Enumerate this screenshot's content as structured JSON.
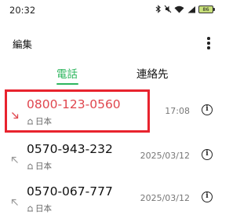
{
  "status_bar": {
    "time": "20:32",
    "battery": "86",
    "icons": [
      "bluetooth-icon",
      "mute-icon",
      "wifi-icon",
      "mobile-signal-icon",
      "battery-icon"
    ]
  },
  "header": {
    "edit_label": "編集",
    "more_icon": "more-vertical-icon"
  },
  "tabs": [
    {
      "label": "電話",
      "active": true
    },
    {
      "label": "連絡先",
      "active": false
    }
  ],
  "colors": {
    "accent": "#2eb65e",
    "missed": "#e0464e",
    "highlight": "#e8232e"
  },
  "calls": [
    {
      "number": "0800-123-0560",
      "location": "日本",
      "time": "17:08",
      "type": "missed",
      "arrow_icon": "incoming-call-icon",
      "highlighted": true
    },
    {
      "number": "0570-943-232",
      "location": "日本",
      "time": "2025/03/12",
      "type": "outgoing",
      "arrow_icon": "outgoing-call-icon",
      "highlighted": false
    },
    {
      "number": "0570-067-777",
      "location": "日本",
      "time": "2025/03/12",
      "type": "outgoing",
      "arrow_icon": "outgoing-call-icon",
      "highlighted": false
    }
  ]
}
